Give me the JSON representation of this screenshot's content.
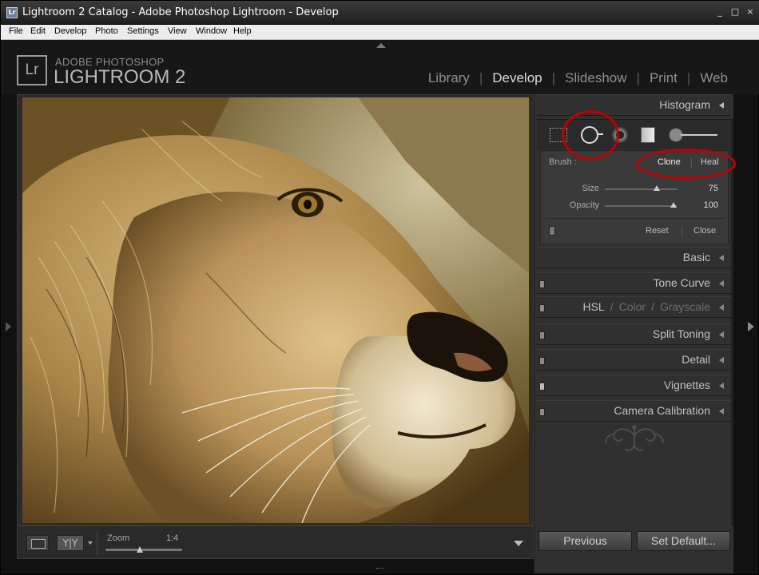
{
  "window": {
    "icon_text": "Lr",
    "title": "Lightroom 2 Catalog - Adobe Photoshop Lightroom - Develop",
    "minimize": "_",
    "maximize": "□",
    "close": "×"
  },
  "menu": {
    "items": [
      "File",
      "Edit",
      "Develop",
      "Photo",
      "Settings",
      "View",
      "Window",
      "Help"
    ]
  },
  "identity": {
    "logo_letters": "Lr",
    "line1": "ADOBE PHOTOSHOP",
    "line2": "LIGHTROOM 2"
  },
  "modules": {
    "items": [
      "Library",
      "Develop",
      "Slideshow",
      "Print",
      "Web"
    ],
    "active": "Develop"
  },
  "toolbar": {
    "zoom_label": "Zoom",
    "zoom_value": "1:4",
    "compare_label": "Y|Y",
    "zoom_level": 0.45
  },
  "panels": {
    "histogram": "Histogram",
    "basic": "Basic",
    "tone_curve": "Tone Curve",
    "hsl": {
      "hsl": "HSL",
      "color": "Color",
      "grayscale": "Grayscale"
    },
    "split_toning": "Split Toning",
    "detail": "Detail",
    "vignettes": "Vignettes",
    "camera_calibration": "Camera Calibration"
  },
  "spot_removal": {
    "brush_label": "Brush :",
    "clone": "Clone",
    "heal": "Heal",
    "size_label": "Size",
    "size_value": "75",
    "size_level": 0.72,
    "opacity_label": "Opacity",
    "opacity_value": "100",
    "opacity_level": 0.95,
    "reset": "Reset",
    "close": "Close"
  },
  "footer": {
    "previous": "Previous",
    "set_default": "Set Default..."
  },
  "colors": {
    "annotation": "#c00000",
    "panel_bg": "#303030",
    "text_active": "#d8d8d8",
    "text_inactive": "#8f8f8f"
  }
}
